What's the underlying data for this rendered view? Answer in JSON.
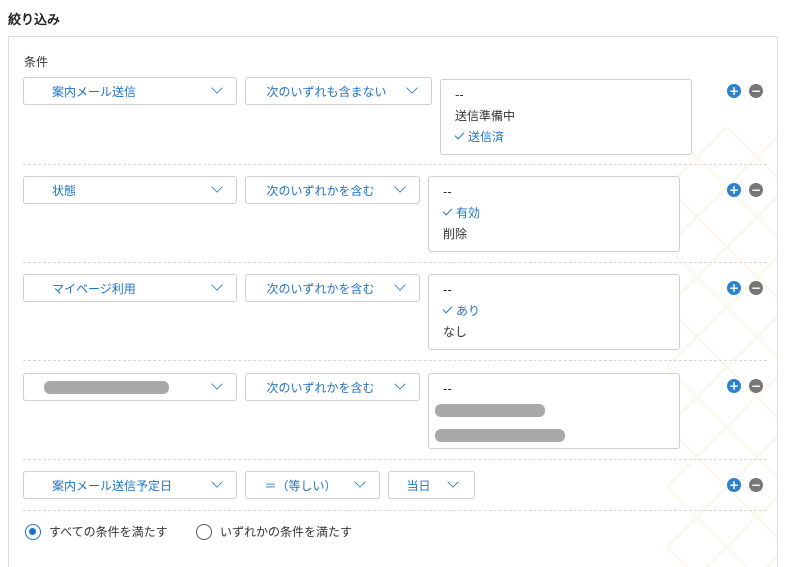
{
  "section_title": "絞り込み",
  "conditions_label": "条件",
  "conditions": [
    {
      "field": "案内メール送信",
      "operator": "次のいずれも含まない",
      "options": [
        {
          "label": "--",
          "selected": false
        },
        {
          "label": "送信準備中",
          "selected": false
        },
        {
          "label": "送信済",
          "selected": true
        }
      ]
    },
    {
      "field": "状態",
      "operator": "次のいずれかを含む",
      "options": [
        {
          "label": "--",
          "selected": false
        },
        {
          "label": "有効",
          "selected": true
        },
        {
          "label": "削除",
          "selected": false
        }
      ]
    },
    {
      "field": "マイページ利用",
      "operator": "次のいずれかを含む",
      "options": [
        {
          "label": "--",
          "selected": false
        },
        {
          "label": "あり",
          "selected": true
        },
        {
          "label": "なし",
          "selected": false
        }
      ]
    },
    {
      "field": "",
      "field_redacted": true,
      "operator": "次のいずれかを含む",
      "options": [
        {
          "label": "--",
          "selected": false
        },
        {
          "label": "",
          "redacted": true
        },
        {
          "label": "",
          "redacted": true
        }
      ]
    },
    {
      "field": "案内メール送信予定日",
      "operator": "＝（等しい）",
      "value": "当日"
    }
  ],
  "match_mode": {
    "options": [
      "すべての条件を満たす",
      "いずれかの条件を満たす"
    ],
    "selected": "すべての条件を満たす"
  },
  "buttons": {
    "add_symbol": "+",
    "remove_symbol": "−"
  },
  "colors": {
    "accent": "#1d73c7",
    "add_button": "#2a83cf",
    "remove_button": "#777777"
  }
}
